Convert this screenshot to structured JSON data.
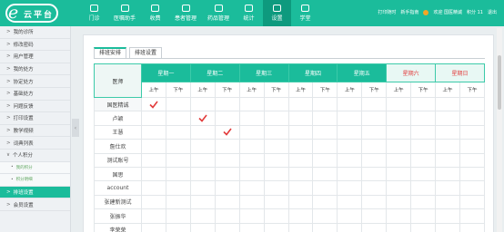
{
  "brand": {
    "logo_letter": "e",
    "logo_text": "云平台"
  },
  "nav": [
    {
      "label": "门诊",
      "icon": "camera-icon",
      "active": false
    },
    {
      "label": "医嘱助手",
      "icon": "doctor-icon",
      "active": false
    },
    {
      "label": "收费",
      "icon": "cash-icon",
      "active": false
    },
    {
      "label": "患者管理",
      "icon": "folder-icon",
      "active": false
    },
    {
      "label": "药品管理",
      "icon": "pill-icon",
      "active": false
    },
    {
      "label": "统计",
      "icon": "chart-icon",
      "active": false
    },
    {
      "label": "设置",
      "icon": "gear-icon",
      "active": true
    },
    {
      "label": "学堂",
      "icon": "book-icon",
      "active": false
    }
  ],
  "topright": {
    "print": "打印随时",
    "msg": "新手指南",
    "welcome": "欢迎 国医精诚",
    "points": "积分 11",
    "logout": "退出"
  },
  "sidebar": [
    {
      "label": "我的诊所",
      "type": "item"
    },
    {
      "label": "修改密码",
      "type": "item"
    },
    {
      "label": "用户管理",
      "type": "item"
    },
    {
      "label": "我的处方",
      "type": "item"
    },
    {
      "label": "协定处方",
      "type": "item"
    },
    {
      "label": "基础处方",
      "type": "item"
    },
    {
      "label": "问题反馈",
      "type": "item"
    },
    {
      "label": "打印设置",
      "type": "item"
    },
    {
      "label": "教学视频",
      "type": "item"
    },
    {
      "label": "词典列表",
      "type": "item"
    },
    {
      "label": "个人积分",
      "type": "open"
    },
    {
      "label": "我的积分",
      "type": "sub"
    },
    {
      "label": "积分明细",
      "type": "sub"
    },
    {
      "label": "排班设置",
      "type": "active"
    },
    {
      "label": "会员设置",
      "type": "item"
    }
  ],
  "tabs": [
    {
      "label": "排班安排",
      "active": true
    },
    {
      "label": "排班设置",
      "active": false
    }
  ],
  "table": {
    "name_header": "医师",
    "days": [
      {
        "label": "星期一",
        "weekend": false
      },
      {
        "label": "星期二",
        "weekend": false
      },
      {
        "label": "星期三",
        "weekend": false
      },
      {
        "label": "星期四",
        "weekend": false
      },
      {
        "label": "星期五",
        "weekend": false
      },
      {
        "label": "星期六",
        "weekend": true
      },
      {
        "label": "星期日",
        "weekend": true
      }
    ],
    "am": "上午",
    "pm": "下午",
    "check_color": "#e23b3b",
    "rows": [
      {
        "name": "国医精诚",
        "checks": [
          0
        ]
      },
      {
        "name": "卢颖",
        "checks": [
          2
        ]
      },
      {
        "name": "王慧",
        "checks": [
          3
        ]
      },
      {
        "name": "詹仕欢",
        "checks": []
      },
      {
        "name": "测试账号",
        "checks": []
      },
      {
        "name": "国思",
        "checks": []
      },
      {
        "name": "account",
        "checks": []
      },
      {
        "name": "张建新测试",
        "checks": []
      },
      {
        "name": "张振华",
        "checks": []
      },
      {
        "name": "李荣荣",
        "checks": []
      }
    ]
  }
}
